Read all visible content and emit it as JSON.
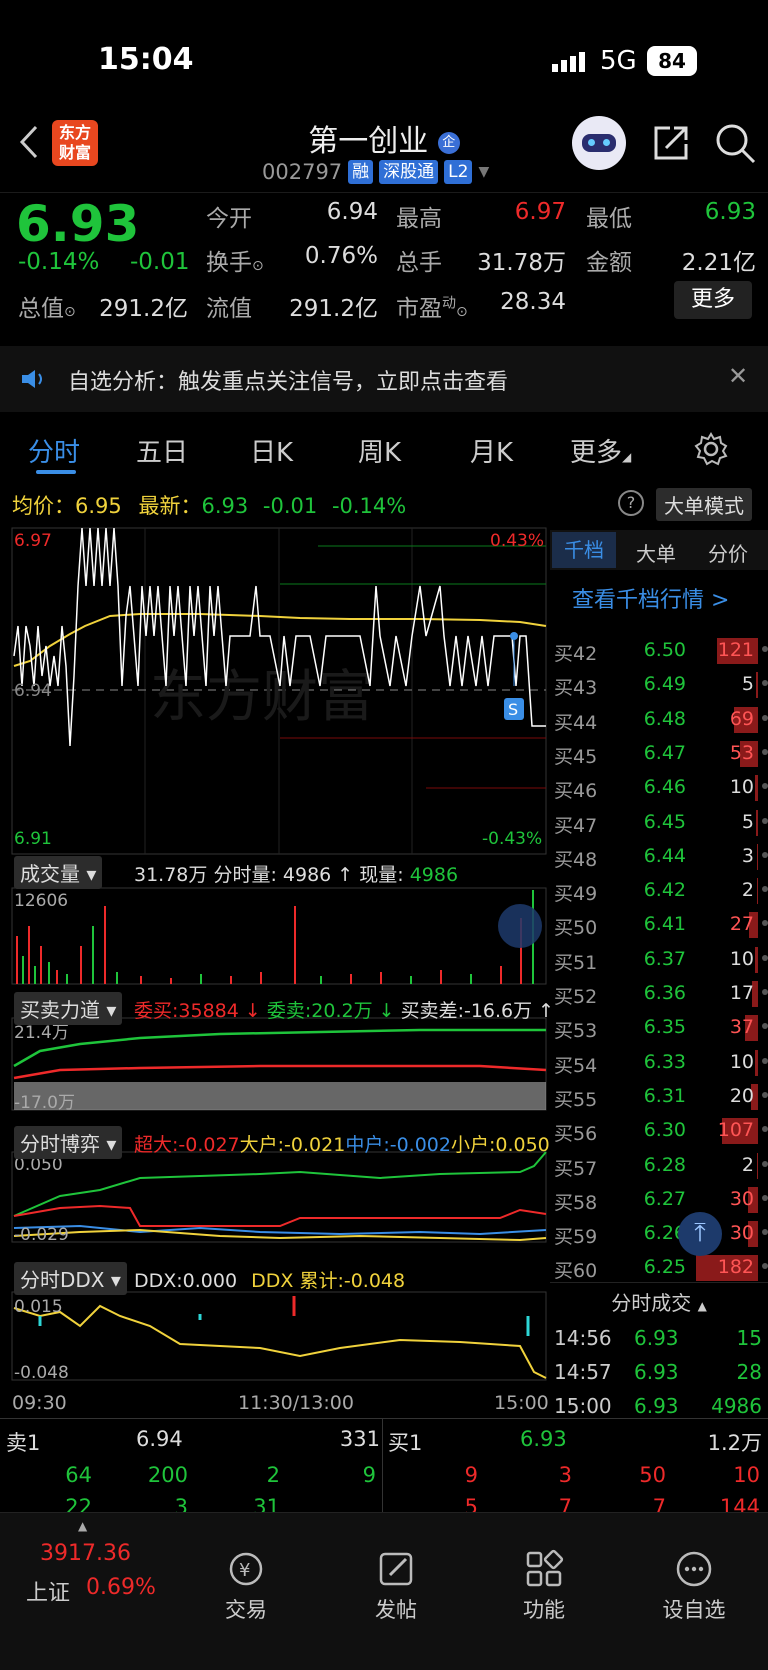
{
  "status": {
    "time": "15:04",
    "network": "5G",
    "battery": "84"
  },
  "nav": {
    "title": "第一创业",
    "code": "002797",
    "tags": [
      "融",
      "深股通",
      "L2"
    ],
    "logo_line1": "东方",
    "logo_line2": "财富"
  },
  "quote": {
    "price": "6.93",
    "change_pct": "-0.14%",
    "change": "-0.01",
    "rows": [
      {
        "l1": "今开",
        "v1": "6.94",
        "l2": "最高",
        "v2": "6.97",
        "l3": "最低",
        "v3": "6.93"
      },
      {
        "l1": "换手",
        "v1": "0.76%",
        "l2": "总手",
        "v2": "31.78万",
        "l3": "金额",
        "v3": "2.21亿"
      },
      {
        "l1": "总值",
        "v1": "291.2亿",
        "l2": "流值",
        "v2": "291.2亿",
        "l3": "市盈",
        "v3": "28.34"
      }
    ],
    "more": "更多"
  },
  "notice": {
    "text": "自选分析：触发重点关注信号，立即点击查看"
  },
  "tabs": [
    "分时",
    "五日",
    "日K",
    "周K",
    "月K",
    "更多"
  ],
  "summary": {
    "avg_label": "均价：",
    "avg": "6.95",
    "latest_label": "最新：",
    "latest": "6.93",
    "chg": "-0.01",
    "pct": "-0.14%",
    "mode": "大单模式"
  },
  "price_chart": {
    "top": "6.97",
    "mid": "6.94",
    "bottom": "6.91",
    "top_pct": "0.43%",
    "bottom_pct": "-0.43%",
    "watermark": "东方财富",
    "marker": "S"
  },
  "volume": {
    "btn": "成交量",
    "text1": "31.78万",
    "text2": "分时量: 4986 ↑",
    "text3": "现量:",
    "text4": "4986",
    "max": "12606"
  },
  "force": {
    "btn": "买卖力道",
    "a": "委买:35884 ↓",
    "b": "委卖:20.2万 ↓",
    "c": "买卖差:-16.6万 ↑",
    "top": "21.4万",
    "bottom": "-17.0万"
  },
  "game": {
    "btn": "分时博弈",
    "a": "超大:-0.027",
    "b": "大户:-0.021",
    "c": "中户:-0.002",
    "d": "小户:0.050",
    "top": "0.050",
    "bottom": "-0.029"
  },
  "ddx": {
    "btn": "分时DDX",
    "a": "DDX:0.000",
    "b": "DDX 累计:-0.048",
    "top": "0.015",
    "bottom": "-0.048"
  },
  "time_axis": [
    "09:30",
    "11:30/13:00",
    "15:00"
  ],
  "right_panel": {
    "tabs": [
      "千档",
      "大单",
      "分价"
    ],
    "link": "查看千档行情 >",
    "levels": [
      {
        "l": "买42",
        "p": "6.50",
        "v": "121"
      },
      {
        "l": "买43",
        "p": "6.49",
        "v": "5"
      },
      {
        "l": "买44",
        "p": "6.48",
        "v": "69"
      },
      {
        "l": "买45",
        "p": "6.47",
        "v": "53"
      },
      {
        "l": "买46",
        "p": "6.46",
        "v": "10"
      },
      {
        "l": "买47",
        "p": "6.45",
        "v": "5"
      },
      {
        "l": "买48",
        "p": "6.44",
        "v": "3"
      },
      {
        "l": "买49",
        "p": "6.42",
        "v": "2"
      },
      {
        "l": "买50",
        "p": "6.41",
        "v": "27"
      },
      {
        "l": "买51",
        "p": "6.37",
        "v": "10"
      },
      {
        "l": "买52",
        "p": "6.36",
        "v": "17"
      },
      {
        "l": "买53",
        "p": "6.35",
        "v": "37"
      },
      {
        "l": "买54",
        "p": "6.33",
        "v": "10"
      },
      {
        "l": "买55",
        "p": "6.31",
        "v": "20"
      },
      {
        "l": "买56",
        "p": "6.30",
        "v": "107"
      },
      {
        "l": "买57",
        "p": "6.28",
        "v": "2"
      },
      {
        "l": "买58",
        "p": "6.27",
        "v": "30"
      },
      {
        "l": "买59",
        "p": "6.26",
        "v": "30"
      },
      {
        "l": "买60",
        "p": "6.25",
        "v": "182"
      }
    ],
    "trades_title": "分时成交",
    "trades": [
      {
        "t": "14:56",
        "p": "6.93",
        "v": "15"
      },
      {
        "t": "14:57",
        "p": "6.93",
        "v": "28"
      },
      {
        "t": "15:00",
        "p": "6.93",
        "v": "4986"
      }
    ]
  },
  "book": {
    "sell1_label": "卖1",
    "sell1_price": "6.94",
    "sell1_vol": "331",
    "buy1_label": "买1",
    "buy1_price": "6.93",
    "buy1_vol": "1.2万",
    "left_r1": [
      "64",
      "200",
      "2",
      "9"
    ],
    "left_r2": [
      "22",
      "3",
      "31"
    ],
    "right_r1": [
      "9",
      "3",
      "50",
      "10"
    ],
    "right_r2": [
      "5",
      "7",
      "7",
      "144"
    ]
  },
  "bottom": {
    "index": "3917.36",
    "index_name": "上证",
    "index_pct": "0.69%",
    "items": [
      "交易",
      "发帖",
      "功能",
      "设自选"
    ]
  }
}
